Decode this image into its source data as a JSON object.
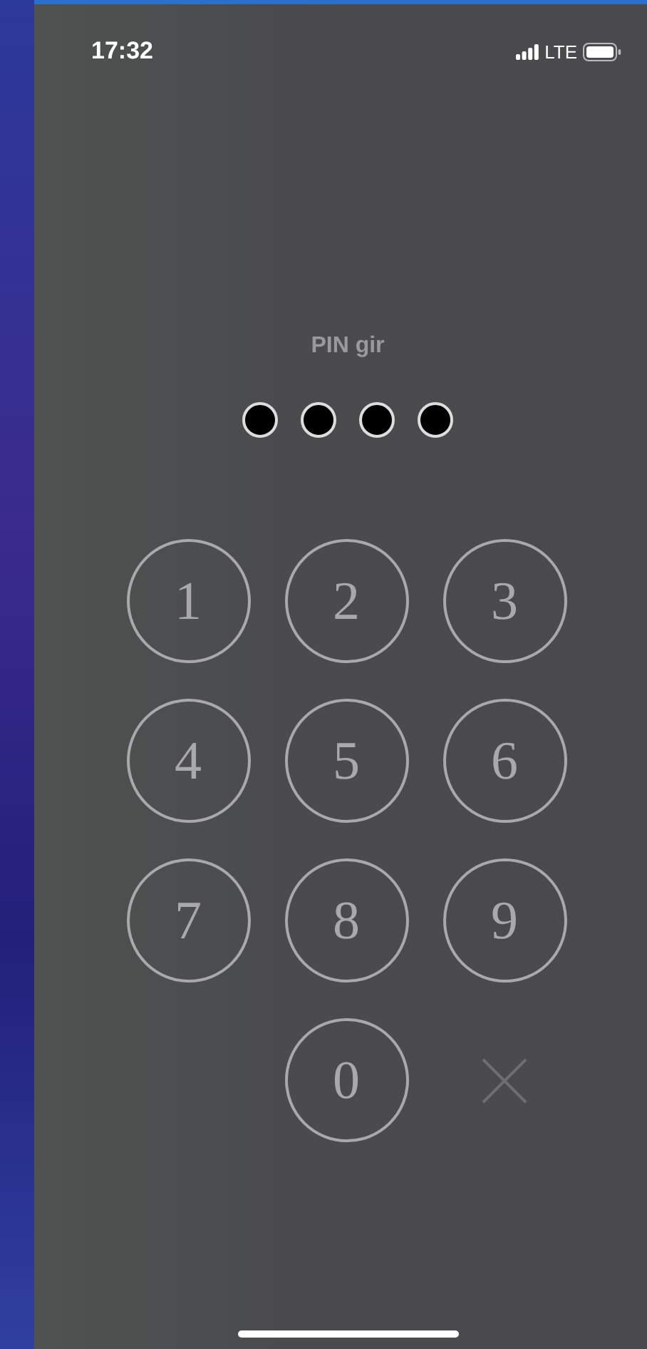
{
  "status_bar": {
    "time": "17:32",
    "network": "LTE"
  },
  "prompt": "PIN gir",
  "pin_dots": [
    {
      "filled": true
    },
    {
      "filled": true
    },
    {
      "filled": true
    },
    {
      "filled": true
    }
  ],
  "keypad": [
    {
      "kind": "digit",
      "label": "1"
    },
    {
      "kind": "digit",
      "label": "2"
    },
    {
      "kind": "digit",
      "label": "3"
    },
    {
      "kind": "digit",
      "label": "4"
    },
    {
      "kind": "digit",
      "label": "5"
    },
    {
      "kind": "digit",
      "label": "6"
    },
    {
      "kind": "digit",
      "label": "7"
    },
    {
      "kind": "digit",
      "label": "8"
    },
    {
      "kind": "digit",
      "label": "9"
    },
    {
      "kind": "empty"
    },
    {
      "kind": "digit",
      "label": "0"
    },
    {
      "kind": "delete"
    }
  ]
}
